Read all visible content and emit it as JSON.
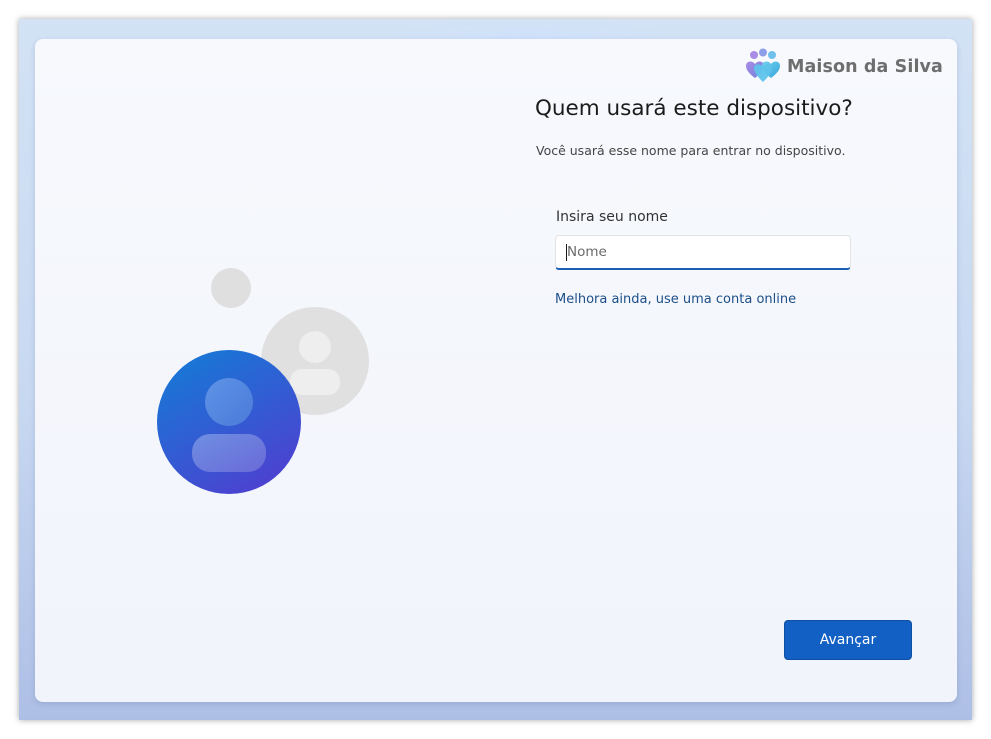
{
  "brand": {
    "name": "Maison da Silva",
    "logo_icon": "people-hearts-logo-icon"
  },
  "page": {
    "title": "Quem usará este dispositivo?",
    "subtitle": "Você usará esse nome para entrar no dispositivo."
  },
  "form": {
    "name_label": "Insira seu nome",
    "name_value": "",
    "name_placeholder": "Nome",
    "online_account_link": "Melhora ainda, use uma conta online"
  },
  "illustration": {
    "icon": "user-accounts-icon"
  },
  "footer": {
    "next_label": "Avançar"
  },
  "colors": {
    "accent": "#1260c4",
    "link": "#1c4f8a",
    "input_focus_border": "#1a5fb4"
  }
}
